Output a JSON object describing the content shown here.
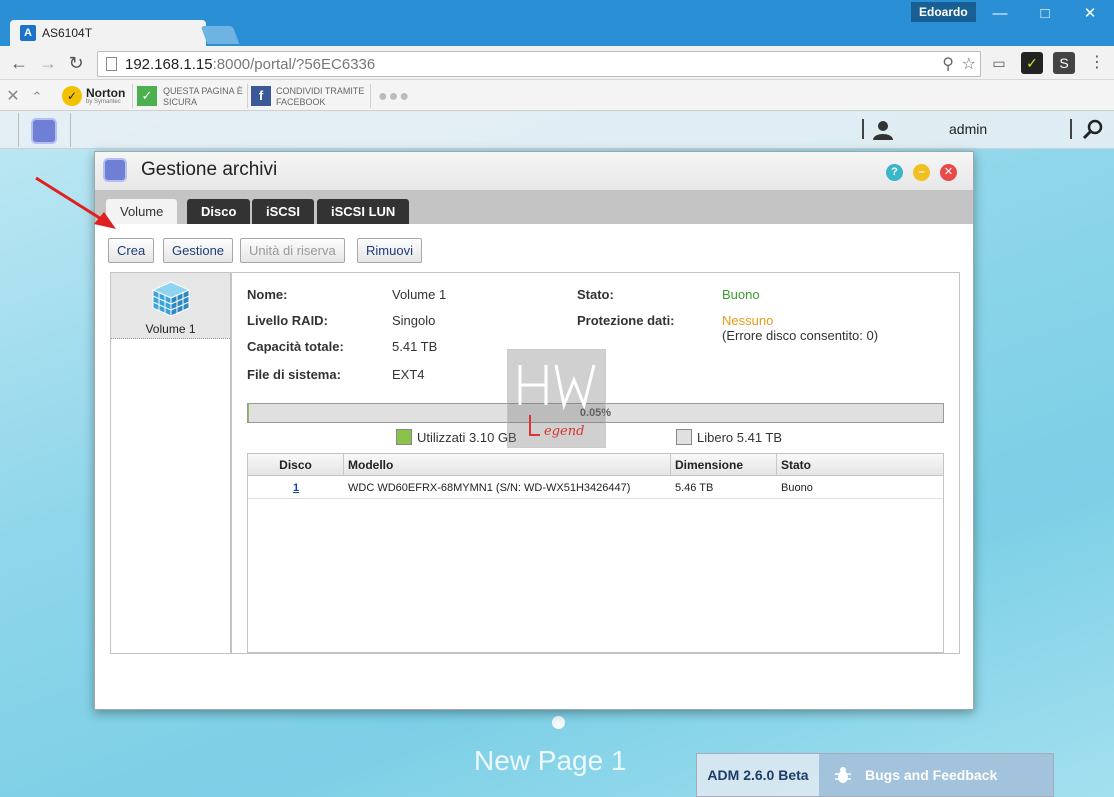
{
  "browser": {
    "tab_title": "AS6104T",
    "profile": "Edoardo",
    "url_host": "192.168.1.15",
    "url_rest": ":8000/portal/?56EC6336",
    "norton": {
      "brand": "Norton",
      "brand_sub": "by Symantec",
      "safe_line1": "QUESTA PAGINA È",
      "safe_line2": "SICURA",
      "share_line1": "CONDIVIDI TRAMITE",
      "share_line2": "FACEBOOK"
    }
  },
  "adm": {
    "user": "admin",
    "page_name": "New Page 1",
    "version": "ADM 2.6.0 Beta",
    "bugs": "Bugs and Feedback"
  },
  "window": {
    "title": "Gestione archivi",
    "tabs": [
      {
        "label": "Volume",
        "active": true
      },
      {
        "label": "Disco",
        "active": false
      },
      {
        "label": "iSCSI",
        "active": false
      },
      {
        "label": "iSCSI LUN",
        "active": false
      }
    ],
    "actions": [
      {
        "label": "Crea",
        "enabled": true
      },
      {
        "label": "Gestione",
        "enabled": true
      },
      {
        "label": "Unità di riserva",
        "enabled": false
      },
      {
        "label": "Rimuovi",
        "enabled": true
      }
    ],
    "volumes": [
      {
        "label": "Volume 1"
      }
    ],
    "details": {
      "name_label": "Nome:",
      "name_value": "Volume 1",
      "raid_label": "Livello RAID:",
      "raid_value": "Singolo",
      "capacity_label": "Capacità totale:",
      "capacity_value": "5.41 TB",
      "fs_label": "File di sistema:",
      "fs_value": "EXT4",
      "status_label": "Stato:",
      "status_value": "Buono",
      "protection_label": "Protezione dati:",
      "protection_value": "Nessuno",
      "protection_note": "(Errore disco consentito: 0)"
    },
    "usage": {
      "percent_text": "0.05%",
      "percent": 0.05,
      "used_label": "Utilizzati 3.10 GB",
      "free_label": "Libero 5.41 TB"
    },
    "disk_table": {
      "headers": [
        "Disco",
        "Modello",
        "Dimensione",
        "Stato"
      ],
      "rows": [
        {
          "disk": "1",
          "model": "WDC WD60EFRX-68MYMN1 (S/N: WD-WX51H3426447)",
          "size": "5.46 TB",
          "status": "Buono"
        }
      ]
    }
  },
  "colors": {
    "used": "#8bc34a",
    "free": "#e0e0e0",
    "good": "#3a9a2a",
    "warn": "#e89a1a"
  }
}
